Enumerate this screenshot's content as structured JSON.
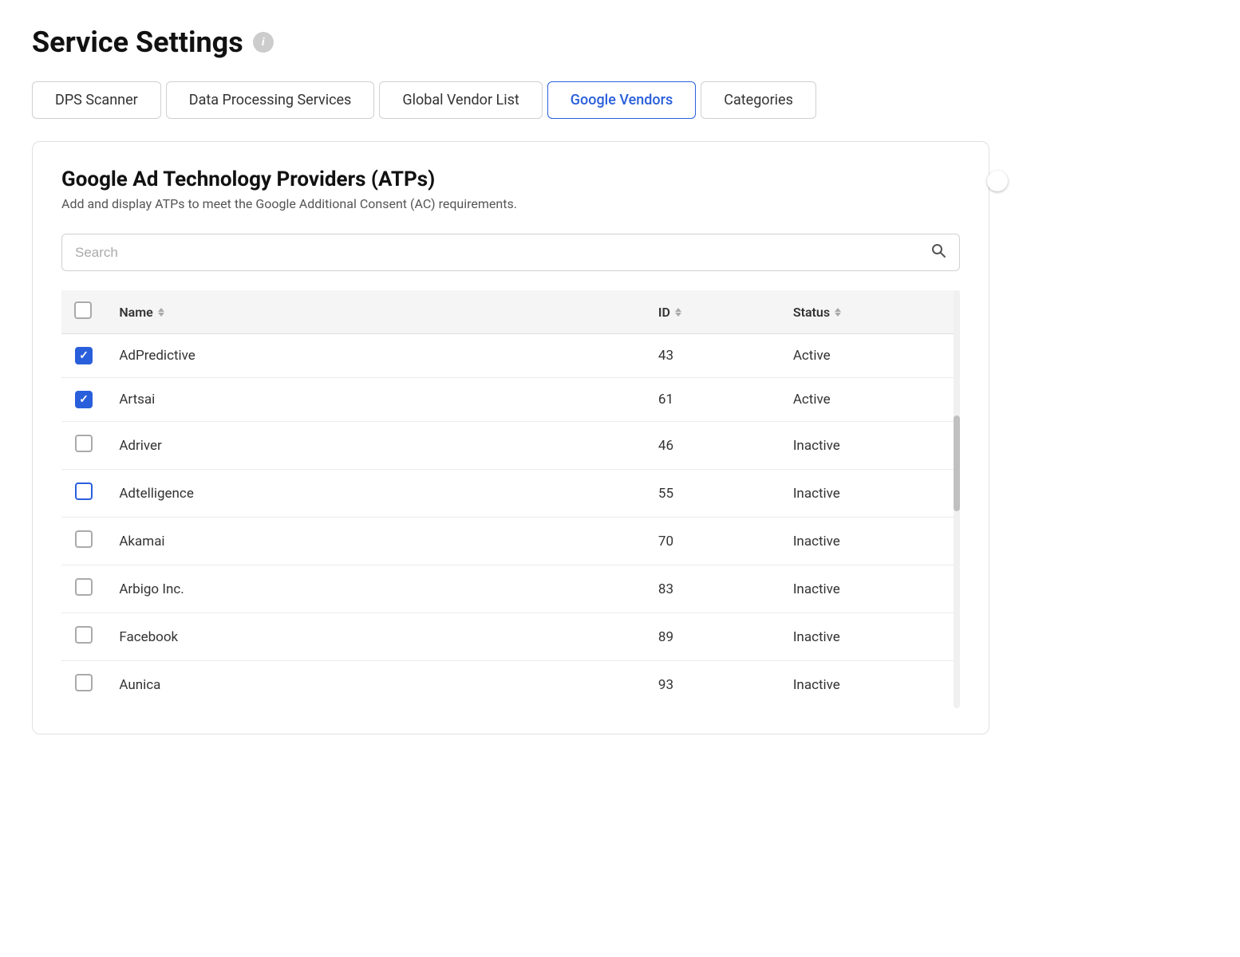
{
  "page": {
    "title": "Service Settings",
    "info_icon_label": "i"
  },
  "tabs": [
    {
      "id": "dps-scanner",
      "label": "DPS Scanner",
      "active": false
    },
    {
      "id": "data-processing-services",
      "label": "Data Processing Services",
      "active": false
    },
    {
      "id": "global-vendor-list",
      "label": "Global Vendor List",
      "active": false
    },
    {
      "id": "google-vendors",
      "label": "Google Vendors",
      "active": true
    },
    {
      "id": "categories",
      "label": "Categories",
      "active": false
    }
  ],
  "card": {
    "title": "Google Ad Technology Providers (ATPs)",
    "subtitle": "Add and display ATPs to meet the Google Additional Consent (AC) requirements.",
    "toggle_enabled": true
  },
  "search": {
    "placeholder": "Search"
  },
  "table": {
    "columns": [
      {
        "id": "name",
        "label": "Name"
      },
      {
        "id": "id",
        "label": "ID"
      },
      {
        "id": "status",
        "label": "Status"
      }
    ],
    "rows": [
      {
        "id": 0,
        "name": "AdPredictive",
        "vendor_id": "43",
        "status": "Active",
        "checked": true,
        "focused": false
      },
      {
        "id": 1,
        "name": "Artsai",
        "vendor_id": "61",
        "status": "Active",
        "checked": true,
        "focused": false
      },
      {
        "id": 2,
        "name": "Adriver",
        "vendor_id": "46",
        "status": "Inactive",
        "checked": false,
        "focused": false
      },
      {
        "id": 3,
        "name": "Adtelligence",
        "vendor_id": "55",
        "status": "Inactive",
        "checked": false,
        "focused": true
      },
      {
        "id": 4,
        "name": "Akamai",
        "vendor_id": "70",
        "status": "Inactive",
        "checked": false,
        "focused": false
      },
      {
        "id": 5,
        "name": "Arbigo Inc.",
        "vendor_id": "83",
        "status": "Inactive",
        "checked": false,
        "focused": false
      },
      {
        "id": 6,
        "name": "Facebook",
        "vendor_id": "89",
        "status": "Inactive",
        "checked": false,
        "focused": false
      },
      {
        "id": 7,
        "name": "Aunica",
        "vendor_id": "93",
        "status": "Inactive",
        "checked": false,
        "focused": false
      }
    ]
  },
  "colors": {
    "active_tab": "#2a5fdb",
    "toggle_on": "#2a5fdb",
    "checkbox_checked": "#2a5fdb"
  }
}
